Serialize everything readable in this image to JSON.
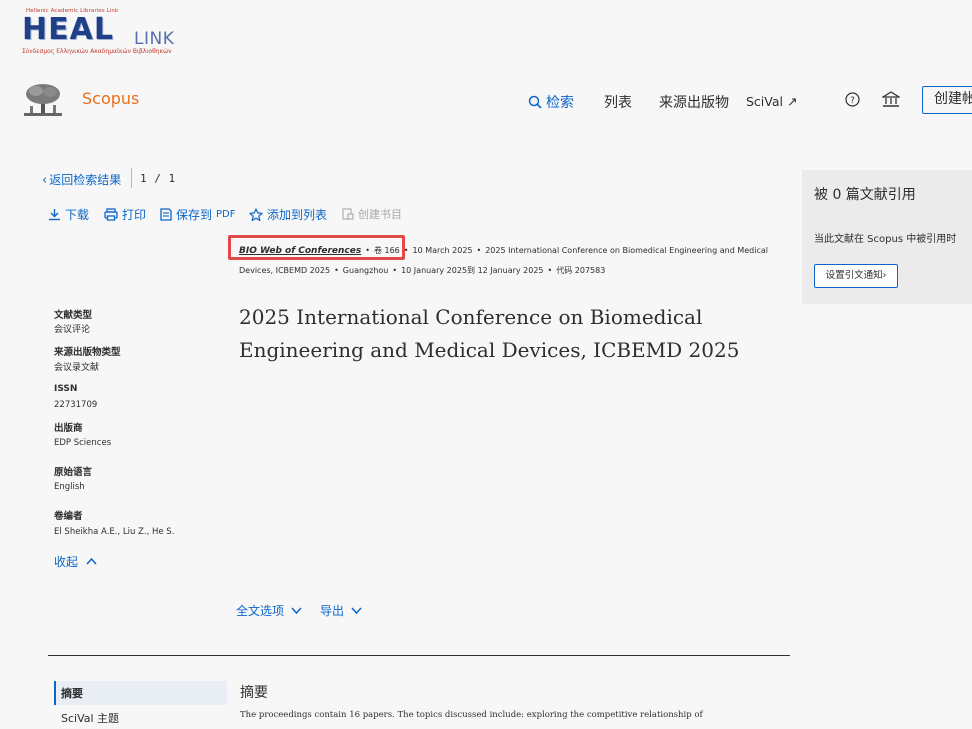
{
  "logo": {
    "top_text": "Hellenic Academic Libraries Link",
    "wordmark": "HEAL",
    "wordmark_suffix": "LINK",
    "subtitle": "Σύνδεσμος Ελληνικών Ακαδημαϊκών Βιβλιοθηκών"
  },
  "header": {
    "brand": "Scopus",
    "nav": {
      "search": "检索",
      "list": "列表",
      "sources": "来源出版物",
      "scival": "SciVal ↗",
      "create_account": "创建帐户"
    }
  },
  "breadcrumb": {
    "back": "返回检索结果",
    "pager": "1 / 1"
  },
  "actions": {
    "download": "下载",
    "print": "打印",
    "save_pdf": "保存到",
    "save_pdf_suffix": "PDF",
    "add_to_list": "添加到列表",
    "create_bib": "创建书目"
  },
  "source": {
    "name": "BIO Web of Conferences",
    "volume_label": "卷",
    "volume": "166",
    "date": "10 March 2025",
    "conference": "2025 International Conference on Biomedical Engineering and Medical Devices, ICBEMD 2025",
    "location": "Guangzhou",
    "conf_dates": "10 January 2025到 12 January 2025",
    "code": "代码 207583"
  },
  "document": {
    "title": "2025 International Conference on Biomedical Engineering and Medical Devices, ICBEMD 2025"
  },
  "metadata": {
    "doc_type_label": "文献类型",
    "doc_type": "会议评论",
    "source_type_label": "来源出版物类型",
    "source_type": "会议录文献",
    "issn_label": "ISSN",
    "issn": "22731709",
    "publisher_label": "出版商",
    "publisher": "EDP Sciences",
    "language_label": "原始语言",
    "language": "English",
    "editors_label": "卷编者",
    "editors": "El Sheikha A.E., Liu Z., He S.",
    "collapse": "收起"
  },
  "options": {
    "full_text": "全文选项",
    "export": "导出"
  },
  "abstract": {
    "side_label": "摘要",
    "side_scival": "SciVal 主题",
    "heading": "摘要",
    "text": "The proceedings contain 16 papers. The topics discussed include: exploring the competitive relationship of"
  },
  "citations": {
    "title": "被 0 篇文献引用",
    "desc": "当此文献在 Scopus 中被引用时",
    "alert": "设置引文通知"
  }
}
